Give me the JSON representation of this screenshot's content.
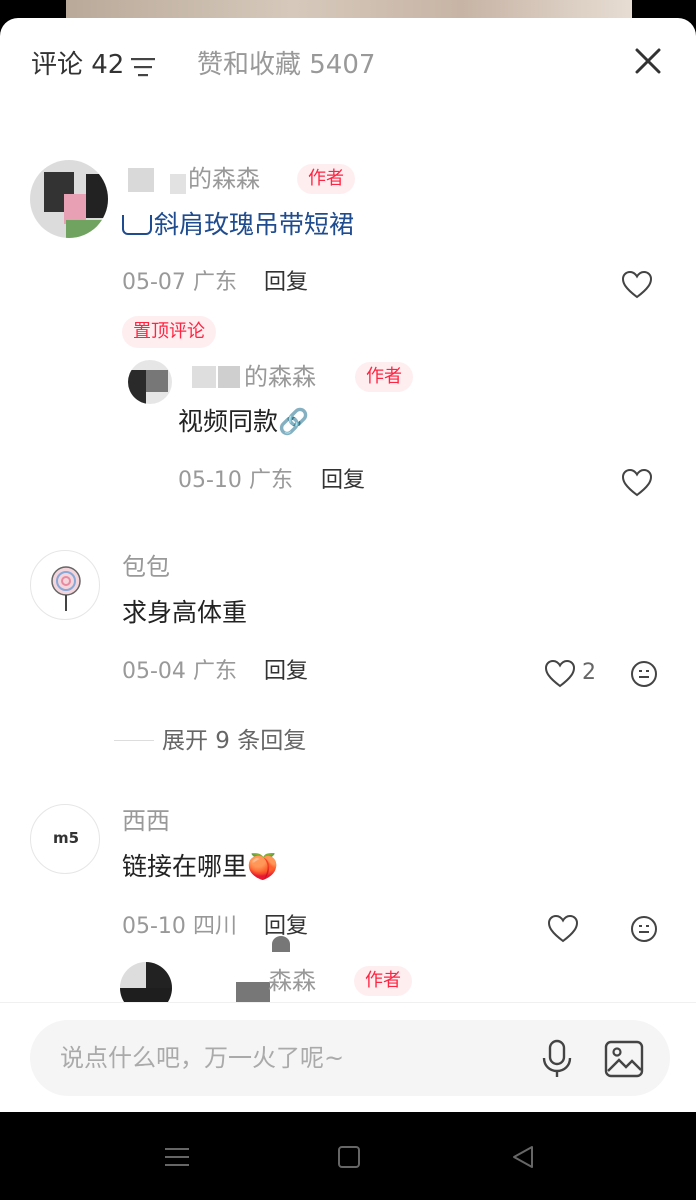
{
  "header": {
    "comments_tab": "评论 42",
    "likes_tab": "赞和收藏 5407",
    "filter_icon": "filter-icon",
    "close_icon": "close-icon"
  },
  "comments": [
    {
      "username": "的森森",
      "badge": "作者",
      "content": "斜肩玫瑰吊带短裙",
      "date": "05-07",
      "location": "广东",
      "reply": "回复",
      "pinned": "置顶评论",
      "replies": [
        {
          "username": "的森森",
          "badge": "作者",
          "content": "视频同款🔗",
          "date": "05-10",
          "location": "广东",
          "reply": "回复"
        }
      ]
    },
    {
      "username": "包包",
      "content": "求身高体重",
      "date": "05-04",
      "location": "广东",
      "reply": "回复",
      "likes": "2",
      "expand": "展开 9 条回复"
    },
    {
      "username": "西西",
      "avatar_text": "m5",
      "content": "链接在哪里🍑",
      "date": "05-10",
      "location": "四川",
      "reply": "回复",
      "replies": [
        {
          "username": "森森",
          "badge": "作者"
        }
      ]
    }
  ],
  "input": {
    "placeholder": "说点什么吧，万一火了呢~",
    "mic_icon": "microphone-icon",
    "image_icon": "image-icon"
  },
  "navbar": {
    "menu_icon": "menu-icon",
    "home_icon": "home-square-icon",
    "back_icon": "back-triangle-icon"
  }
}
